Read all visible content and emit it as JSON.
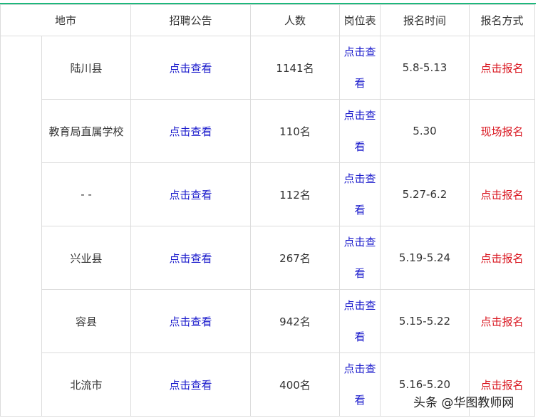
{
  "header": [
    "地市",
    "招聘公告",
    "人数",
    "岗位表",
    "报名时间",
    "报名方式"
  ],
  "rows": [
    {
      "city": "陆川县",
      "notice": "点击查看",
      "count": "1141名",
      "positions": "点击查看",
      "time": "5.8-5.13",
      "method": "点击报名",
      "method_type": "link"
    },
    {
      "city": "教育局直属学校",
      "notice": "点击查看",
      "count": "110名",
      "positions": "点击查看",
      "time": "5.30",
      "method": "现场报名",
      "method_type": "text"
    },
    {
      "city": "- -",
      "notice": "点击查看",
      "count": "112名",
      "positions": "点击查看",
      "time": "5.27-6.2",
      "method": "点击报名",
      "method_type": "link"
    },
    {
      "city": "兴业县",
      "notice": "点击查看",
      "count": "267名",
      "positions": "点击查看",
      "time": "5.19-5.24",
      "method": "点击报名",
      "method_type": "link"
    },
    {
      "city": "容县",
      "notice": "点击查看",
      "count": "942名",
      "positions": "点击查看",
      "time": "5.15-5.22",
      "method": "点击报名",
      "method_type": "link"
    },
    {
      "city": "北流市",
      "notice": "点击查看",
      "count": "400名",
      "positions": "点击查看",
      "time": "5.16-5.20",
      "method": "点击报名",
      "method_type": "link"
    }
  ],
  "watermark": "头条 @华图教师网",
  "colors": {
    "accent": "#1db87c",
    "link": "#1a1acc",
    "signup": "#d9141e"
  }
}
